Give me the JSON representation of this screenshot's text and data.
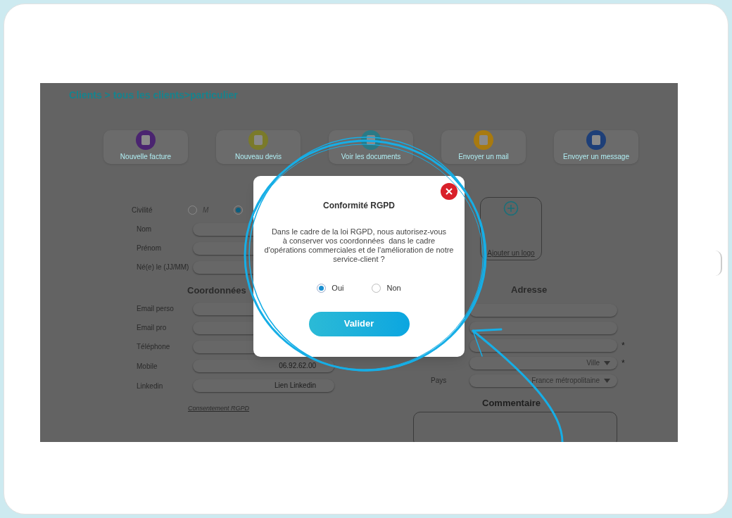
{
  "breadcrumb": "Clients > tous les clients>particulier",
  "actions": [
    {
      "label": "Nouvelle facture",
      "color": "#4a2470"
    },
    {
      "label": "Nouveau devis",
      "color": "#7a7a2a"
    },
    {
      "label": "Voir les documents",
      "color": "#2a7a86"
    },
    {
      "label": "Envoyer un mail",
      "color": "#a87a10"
    },
    {
      "label": "Envoyer un message",
      "color": "#1e3f78"
    }
  ],
  "civility": {
    "label": "Civilité",
    "options": [
      {
        "label": "M",
        "selected": false
      },
      {
        "selected": true
      }
    ]
  },
  "identity_fields": [
    {
      "label": "Nom"
    },
    {
      "label": "Prénom"
    },
    {
      "label": "Né(e) le (JJ/MM)"
    }
  ],
  "contact": {
    "title": "Coordonnées",
    "fields": [
      {
        "label": "Email perso"
      },
      {
        "label": "Email pro"
      },
      {
        "label": "Téléphone"
      },
      {
        "label": "Mobile",
        "value": "06.92.62.00"
      },
      {
        "label": "Linkedin",
        "placeholder": "Lien Linkedin"
      }
    ],
    "consent_link": "Consentement RGPD"
  },
  "logo": {
    "label": "Ajouter un logo"
  },
  "address": {
    "title": "Adresse",
    "fields": [
      {
        "kind": "text"
      },
      {
        "kind": "text"
      },
      {
        "kind": "text",
        "required_mark": "*"
      },
      {
        "kind": "select",
        "value": "Ville",
        "required_mark": "*"
      },
      {
        "kind": "select",
        "label": "Pays",
        "value": "France métropolitaine"
      }
    ]
  },
  "comment": {
    "title": "Commentaire"
  },
  "dialog": {
    "title": "Conformité RGPD",
    "message": "Dans le cadre de la loi RGPD, nous autorisez-vous\nà conserver vos coordonnées  dans le cadre\nd'opérations commerciales et de l'amélioration de notre\nservice-client ?",
    "options": [
      {
        "label": "Oui",
        "selected": true
      },
      {
        "label": "Non",
        "selected": false
      }
    ],
    "submit": "Valider"
  }
}
